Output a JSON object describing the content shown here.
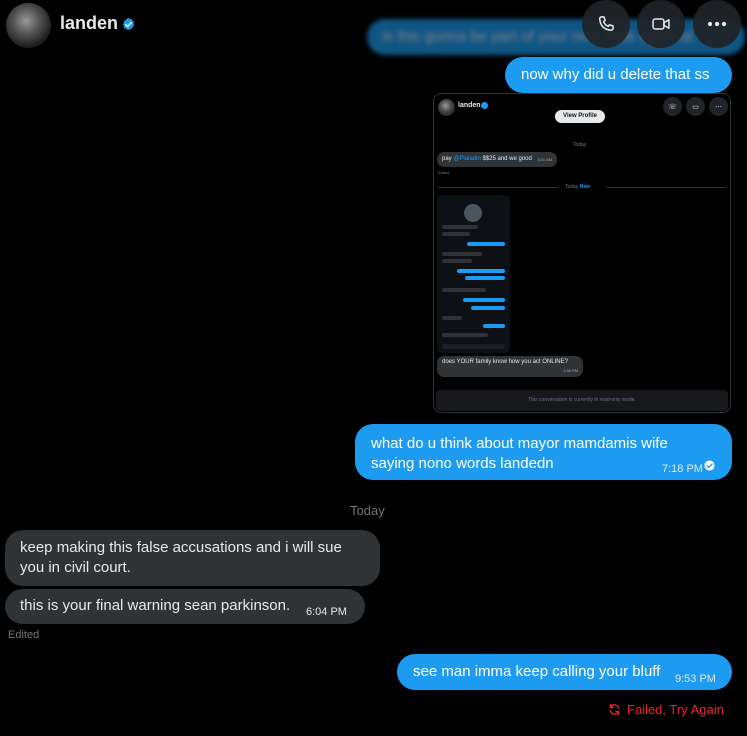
{
  "header": {
    "contact_name": "landen"
  },
  "ghost_message": "is this gonna be part of your now table again at",
  "messages": {
    "m1": "now why did u delete that ss",
    "m2": "what do u think about mayor mamdamis wife saying nono words landedn",
    "m2_time": "7:18 PM",
    "separator": "Today",
    "m3": "keep making this false accusations and i will sue you in civil court.",
    "m4": "this is your final warning sean parkinson.",
    "m4_time": "6:04 PM",
    "edited": "Edited",
    "m5": "see man imma keep calling your bluff",
    "m5_time": "9:53 PM",
    "failed": "Failed, Try Again"
  },
  "screenshot": {
    "name": "landen",
    "view_profile": "View Profile",
    "today": "Today",
    "msg1_pre": "pay ",
    "msg1_handle": "@Plaladin",
    "msg1_post": " $$25 and we good",
    "msg1_time": "3:31 AM",
    "edited": "Edited",
    "new_label": "Today",
    "new_tag": "New",
    "msg2": "does YOUR family know how you act ONLINE?",
    "msg2_time": "1:36 PM",
    "footer": "This conversation is currently in read-only mode."
  },
  "colors": {
    "outgoing": "#1d9bf0",
    "incoming": "#2f3336",
    "failed": "#f4212e",
    "muted": "#71767b"
  }
}
